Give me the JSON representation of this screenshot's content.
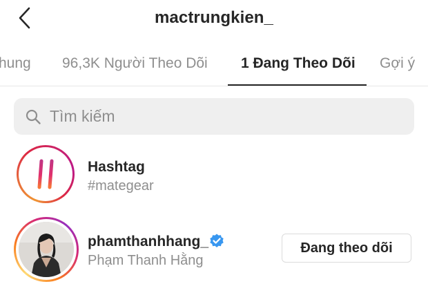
{
  "header": {
    "title": "mactrungkien_",
    "back_icon": "chevron-left-icon"
  },
  "tabs": [
    {
      "label": "hung",
      "active": false
    },
    {
      "label": "96,3K Người Theo Dõi",
      "active": false
    },
    {
      "label": "1 Đang Theo Dõi",
      "active": true
    },
    {
      "label": "Gợi ý",
      "active": false
    }
  ],
  "search": {
    "placeholder": "Tìm kiếm",
    "value": "",
    "icon": "search-icon"
  },
  "list": {
    "hashtag": {
      "title": "Hashtag",
      "subtitle": "#mategear",
      "icon": "hashtag-icon"
    },
    "user": {
      "username": "phamthanhhang_",
      "full_name": "Phạm Thanh Hằng",
      "verified": true,
      "button_label": "Đang theo dõi"
    }
  },
  "colors": {
    "text_primary": "#262626",
    "text_secondary": "#8e8e8e",
    "search_bg": "#efefef",
    "verified_blue": "#3897f0",
    "story_gradient": [
      "#feda75",
      "#fa7e1e",
      "#d62976",
      "#962fbf"
    ]
  }
}
